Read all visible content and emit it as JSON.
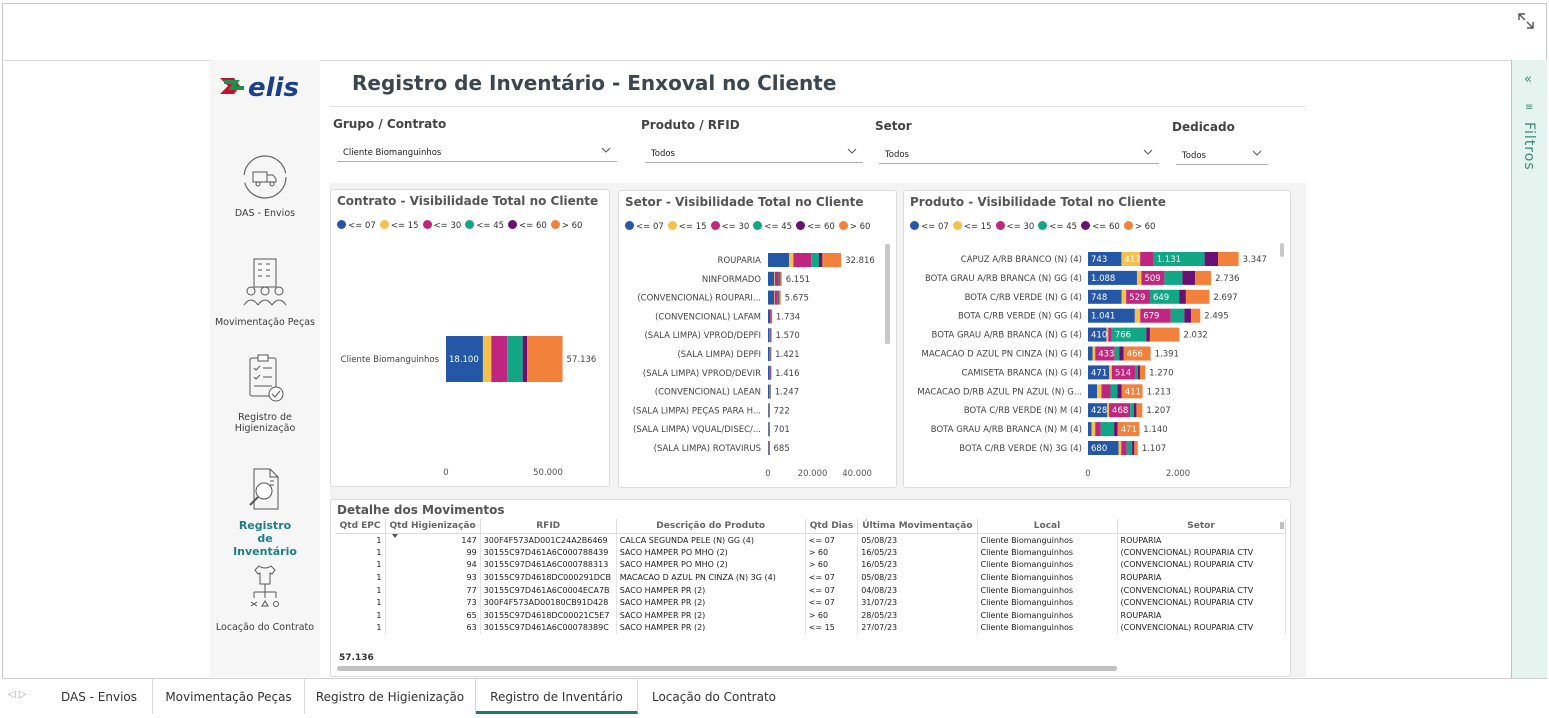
{
  "header": {
    "title": "Registro de Inventário - Enxoval no Cliente",
    "logo_text": "elis"
  },
  "nav": {
    "items": [
      {
        "label": "DAS - Envios"
      },
      {
        "label": "Movimentação Peças"
      },
      {
        "label": "Registro de Higienização"
      },
      {
        "label": "Registro de Inventário"
      },
      {
        "label": "Locação do Contrato"
      }
    ]
  },
  "filters": {
    "grupo": {
      "label": "Grupo / Contrato",
      "value": "Cliente Biomanguinhos"
    },
    "produto": {
      "label": "Produto / RFID",
      "value": "Todos"
    },
    "setor": {
      "label": "Setor",
      "value": "Todos"
    },
    "dedicado": {
      "label": "Dedicado",
      "value": "Todos"
    }
  },
  "filter_pane": {
    "label": "Filtros"
  },
  "legend": [
    "<= 07",
    "<= 15",
    "<= 30",
    "<= 45",
    "<= 60",
    ">  60"
  ],
  "colors": [
    "#2557a7",
    "#f5c14b",
    "#c0267f",
    "#12a784",
    "#6a0f73",
    "#f1813b"
  ],
  "chart_data": [
    {
      "type": "bar",
      "title": "Contrato - Visibilidade Total no Cliente",
      "categories": [
        "Cliente Biomanguinhos"
      ],
      "series": [
        {
          "name": "<= 07",
          "values": [
            18100
          ]
        },
        {
          "name": "<= 15",
          "values": [
            4100
          ]
        },
        {
          "name": "<= 30",
          "values": [
            7800
          ]
        },
        {
          "name": "<= 45",
          "values": [
            7600
          ]
        },
        {
          "name": "<= 60",
          "values": [
            2200
          ]
        },
        {
          "name": ">  60",
          "values": [
            17336
          ]
        }
      ],
      "segment_labels": [
        [
          "18.100"
        ]
      ],
      "totals": [
        "57.136"
      ],
      "xticks": [
        "0",
        "50.000"
      ],
      "xlim": [
        0,
        75000
      ]
    },
    {
      "type": "bar",
      "title": "Setor - Visibilidade Total no Cliente",
      "categories": [
        "ROUPARIA",
        "NINFORMADO",
        "(CONVENCIONAL) ROUPARI...",
        "(CONVENCIONAL) LAFAM",
        "(SALA LIMPA) VPROD/DEPFI",
        "(SALA LIMPA) DEPFI",
        "(SALA LIMPA) VPROD/DEVIR",
        "(CONVENCIONAL) LAEAN",
        "(SALA LIMPA) PEÇAS PARA H...",
        "(SALA LIMPA) VQUAL/DISEC/...",
        "(SALA LIMPA) ROTAVIRUS"
      ],
      "series": [
        {
          "name": "<= 07",
          "values": [
            9500,
            2800,
            2700,
            900,
            700,
            650,
            700,
            600,
            350,
            350,
            300
          ]
        },
        {
          "name": "<= 15",
          "values": [
            1900,
            300,
            300,
            100,
            120,
            100,
            100,
            100,
            50,
            50,
            50
          ]
        },
        {
          "name": "<= 30",
          "values": [
            8000,
            1600,
            1300,
            400,
            350,
            300,
            300,
            270,
            150,
            150,
            150
          ]
        },
        {
          "name": "<= 45",
          "values": [
            3500,
            500,
            450,
            150,
            150,
            150,
            130,
            120,
            70,
            70,
            70
          ]
        },
        {
          "name": "<= 60",
          "values": [
            1500,
            350,
            325,
            84,
            90,
            71,
            86,
            57,
            42,
            31,
            35
          ]
        },
        {
          "name": ">  60",
          "values": [
            8416,
            601,
            600,
            100,
            160,
            150,
            100,
            100,
            60,
            50,
            80
          ]
        }
      ],
      "totals": [
        "32.816",
        "6.151",
        "5.675",
        "1.734",
        "1.570",
        "1.421",
        "1.416",
        "1.247",
        "722",
        "701",
        "685"
      ],
      "xticks": [
        "0",
        "20.000",
        "40.000"
      ],
      "xlim": [
        0,
        44000
      ]
    },
    {
      "type": "bar",
      "title": "Produto - Visibilidade Total no Cliente",
      "categories": [
        "CAPUZ A/RB BRANCO (N) (4)",
        "BOTA GRAU A/RB BRANCA (N) GG (4)",
        "BOTA C/RB VERDE (N) G (4)",
        "BOTA C/RB VERDE (N) GG (4)",
        "BOTA GRAU A/RB BRANCA (N) G (4)",
        "MACACAO D AZUL PN CINZA (N) G (4)",
        "CAMISETA BRANCA (N) G (4)",
        "MACACAO D/RB AZUL PN AZUL (N) G...",
        "BOTA C/RB VERDE (N) M (4)",
        "BOTA GRAU A/RB BRANCA (N) M (4)",
        "BOTA C/RB VERDE (N) 3G (4)"
      ],
      "series": [
        {
          "name": "<= 07",
          "values": [
            743,
            1088,
            748,
            1041,
            410,
            100,
            471,
            200,
            428,
            80,
            680
          ]
        },
        {
          "name": "<= 15",
          "values": [
            417,
            100,
            100,
            120,
            40,
            60,
            60,
            100,
            40,
            80,
            60
          ]
        },
        {
          "name": "<= 30",
          "values": [
            300,
            509,
            529,
            679,
            80,
            433,
            514,
            200,
            468,
            120,
            120
          ]
        },
        {
          "name": "<= 45",
          "values": [
            1131,
            400,
            649,
            300,
            766,
            100,
            60,
            150,
            80,
            300,
            120
          ]
        },
        {
          "name": "<= 60",
          "values": [
            300,
            280,
            150,
            150,
            80,
            100,
            50,
            100,
            60,
            80,
            50
          ]
        },
        {
          "name": ">  60",
          "values": [
            456,
            359,
            521,
            205,
            656,
            598,
            115,
            463,
            131,
            480,
            77
          ]
        }
      ],
      "segment_labels": [
        [
          "743",
          "417",
          "",
          "1.131",
          "",
          ""
        ],
        [
          "1.088",
          "",
          "509",
          "",
          "",
          ""
        ],
        [
          "748",
          "",
          "529",
          "649",
          "",
          ""
        ],
        [
          "1.041",
          "",
          "679",
          "",
          "",
          ""
        ],
        [
          "410",
          "",
          "",
          "766",
          "",
          ""
        ],
        [
          "",
          "",
          "433",
          "",
          "",
          "466"
        ],
        [
          "471",
          "",
          "514",
          "",
          "",
          ""
        ],
        [
          "",
          "",
          "",
          "",
          "",
          "411"
        ],
        [
          "428",
          "",
          "468",
          "",
          "",
          ""
        ],
        [
          "",
          "",
          "",
          "",
          "",
          "471"
        ],
        [
          "680",
          "",
          "",
          "",
          "",
          ""
        ]
      ],
      "totals": [
        "3.347",
        "2.736",
        "2.697",
        "2.495",
        "2.032",
        "1.391",
        "1.270",
        "1.213",
        "1.207",
        "1.140",
        "1.107"
      ],
      "xticks": [
        "0",
        "2.000"
      ],
      "xlim": [
        0,
        4000
      ]
    }
  ],
  "table": {
    "title": "Detalhe dos Movimentos",
    "columns": [
      "Qtd EPC",
      "Qtd Higienização",
      "RFID",
      "Descrição do Produto",
      "Qtd Dias",
      "Última Movimentação",
      "Local",
      "Setor"
    ],
    "rows": [
      [
        "1",
        "147",
        "300F4F573AD001C24A2B6469",
        "CALCA SEGUNDA PELE (N) GG (4)",
        "<= 07",
        "05/08/23",
        "Cliente Biomanguinhos",
        "ROUPARIA"
      ],
      [
        "1",
        "99",
        "30155C97D461A6C000788439",
        "SACO HAMPER PO MHO (2)",
        ">  60",
        "16/05/23",
        "Cliente Biomanguinhos",
        "(CONVENCIONAL) ROUPARIA CTV"
      ],
      [
        "1",
        "94",
        "30155C97D461A6C000788313",
        "SACO HAMPER PO MHO (2)",
        ">  60",
        "16/05/23",
        "Cliente Biomanguinhos",
        "(CONVENCIONAL) ROUPARIA CTV"
      ],
      [
        "1",
        "93",
        "30155C97D4618DC000291DCB",
        "MACACAO D AZUL PN CINZA (N) 3G (4)",
        "<= 07",
        "05/08/23",
        "Cliente Biomanguinhos",
        "ROUPARIA"
      ],
      [
        "1",
        "77",
        "30155C97D461A6C0004ECA7B",
        "SACO HAMPER PR (2)",
        "<= 07",
        "04/08/23",
        "Cliente Biomanguinhos",
        "(CONVENCIONAL) ROUPARIA CTV"
      ],
      [
        "1",
        "73",
        "300F4F573AD00180CB91D428",
        "SACO HAMPER PR (2)",
        "<= 07",
        "31/07/23",
        "Cliente Biomanguinhos",
        "(CONVENCIONAL) ROUPARIA CTV"
      ],
      [
        "1",
        "65",
        "30155C97D4618DC00021C5E7",
        "SACO HAMPER PR (2)",
        ">  60",
        "28/05/23",
        "Cliente Biomanguinhos",
        "ROUPARIA"
      ],
      [
        "1",
        "63",
        "30155C97D461A6C00078389C",
        "SACO HAMPER PR (2)",
        "<= 15",
        "27/07/23",
        "Cliente Biomanguinhos",
        "(CONVENCIONAL) ROUPARIA CTV"
      ]
    ],
    "total": "57.136"
  },
  "tabs": [
    "DAS - Envios",
    "Movimentação Peças",
    "Registro de Higienização",
    "Registro de Inventário",
    "Locação do Contrato"
  ]
}
